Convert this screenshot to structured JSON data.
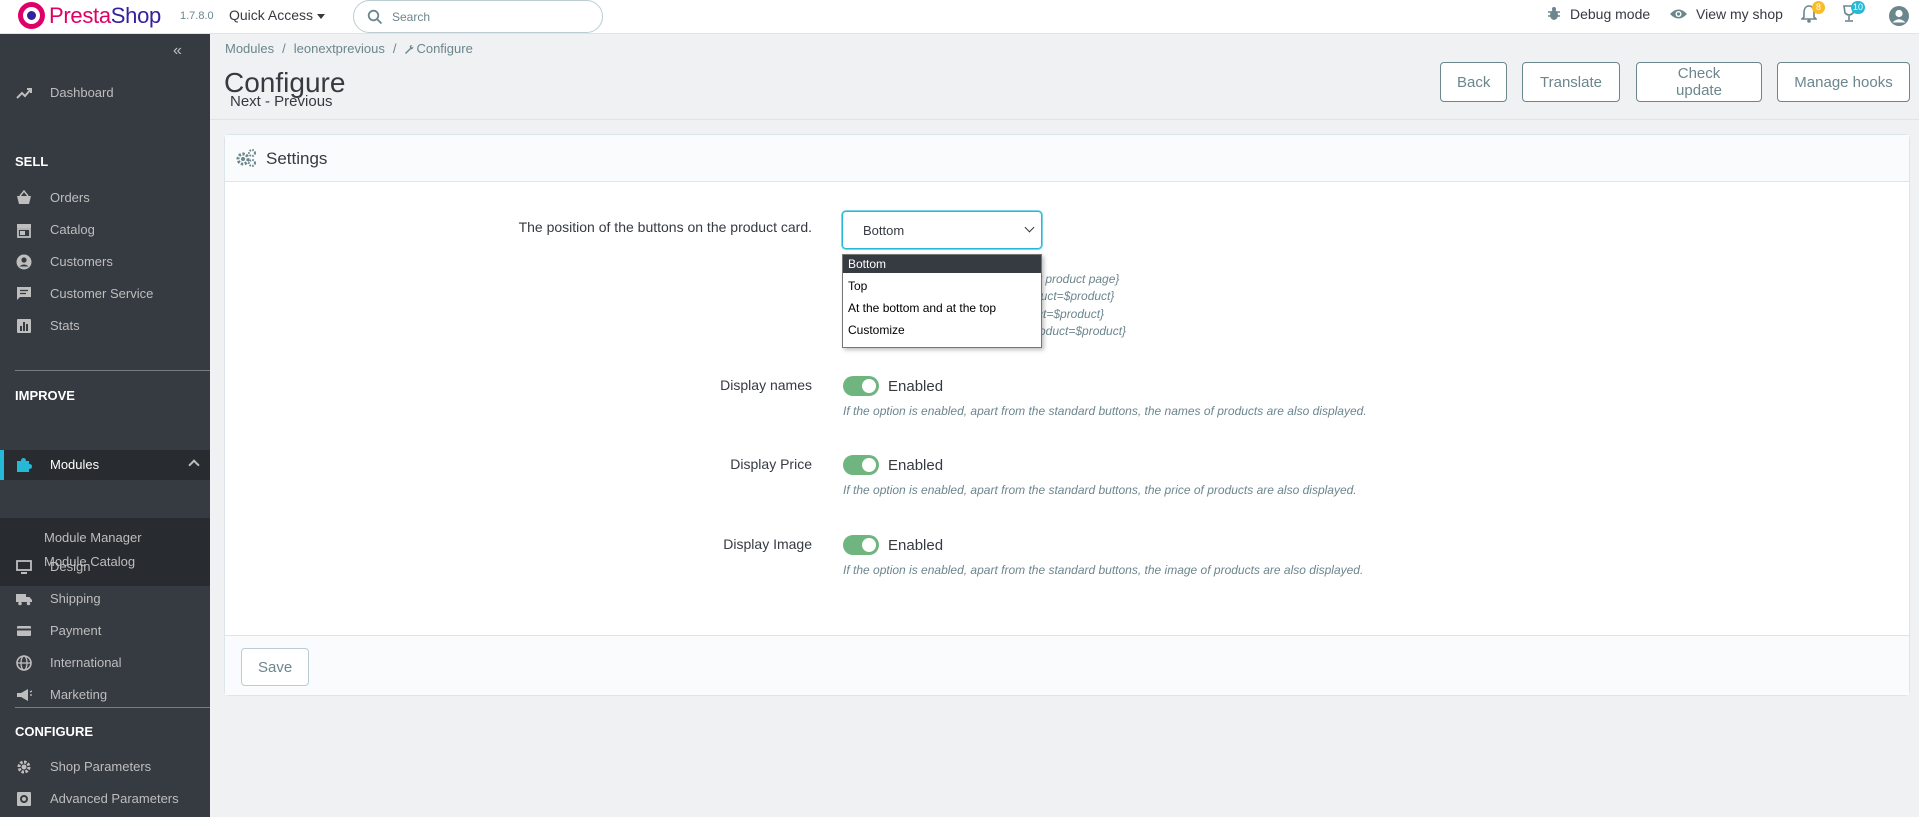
{
  "brand": {
    "name_part1": "Presta",
    "name_part2": "Shop",
    "version": "1.7.8.0"
  },
  "topbar": {
    "quick_access": "Quick Access",
    "search_placeholder": "Search",
    "debug_mode": "Debug mode",
    "view_shop": "View my shop",
    "orders_badge": "8",
    "customers_badge": "10"
  },
  "sidebar": {
    "dashboard": "Dashboard",
    "sell_header": "SELL",
    "sell": [
      "Orders",
      "Catalog",
      "Customers",
      "Customer Service",
      "Stats"
    ],
    "improve_header": "IMPROVE",
    "modules": "Modules",
    "module_subs": [
      "Module Manager",
      "Module Catalog"
    ],
    "improve": [
      "Design",
      "Shipping",
      "Payment",
      "International",
      "Marketing"
    ],
    "configure_header": "CONFIGURE",
    "configure": [
      "Shop Parameters",
      "Advanced Parameters"
    ]
  },
  "breadcrumb": {
    "items": [
      "Modules",
      "leonextprevious",
      "Configure"
    ]
  },
  "header": {
    "title": "Configure",
    "subtitle": "Next - Previous",
    "buttons": [
      "Back",
      "Translate",
      "Check update",
      "Manage hooks"
    ]
  },
  "panel": {
    "title": "Settings",
    "position_label": "The position of the buttons on the product card.",
    "position_value": "Bottom",
    "position_options": [
      "Bottom",
      "Top",
      "At the bottom and at the top",
      "Customize"
    ],
    "position_help": [
      "y product page}",
      "duct=$product}",
      "ct=$product}",
      "roduct=$product}"
    ],
    "switches": [
      {
        "label": "Display names",
        "state": "Enabled",
        "help": "If the option is enabled, apart from the standard buttons, the names of products are also displayed."
      },
      {
        "label": "Display Price",
        "state": "Enabled",
        "help": "If the option is enabled, apart from the standard buttons, the price of products are also displayed."
      },
      {
        "label": "Display Image",
        "state": "Enabled",
        "help": "If the option is enabled, apart from the standard buttons, the image of products are also displayed."
      }
    ],
    "save": "Save"
  },
  "colors": {
    "brand_pink": "#df0067",
    "brand_blue": "#34219e",
    "accent": "#25b9d7",
    "switch_on": "#70b580",
    "sidebar_bg": "#363a41"
  }
}
